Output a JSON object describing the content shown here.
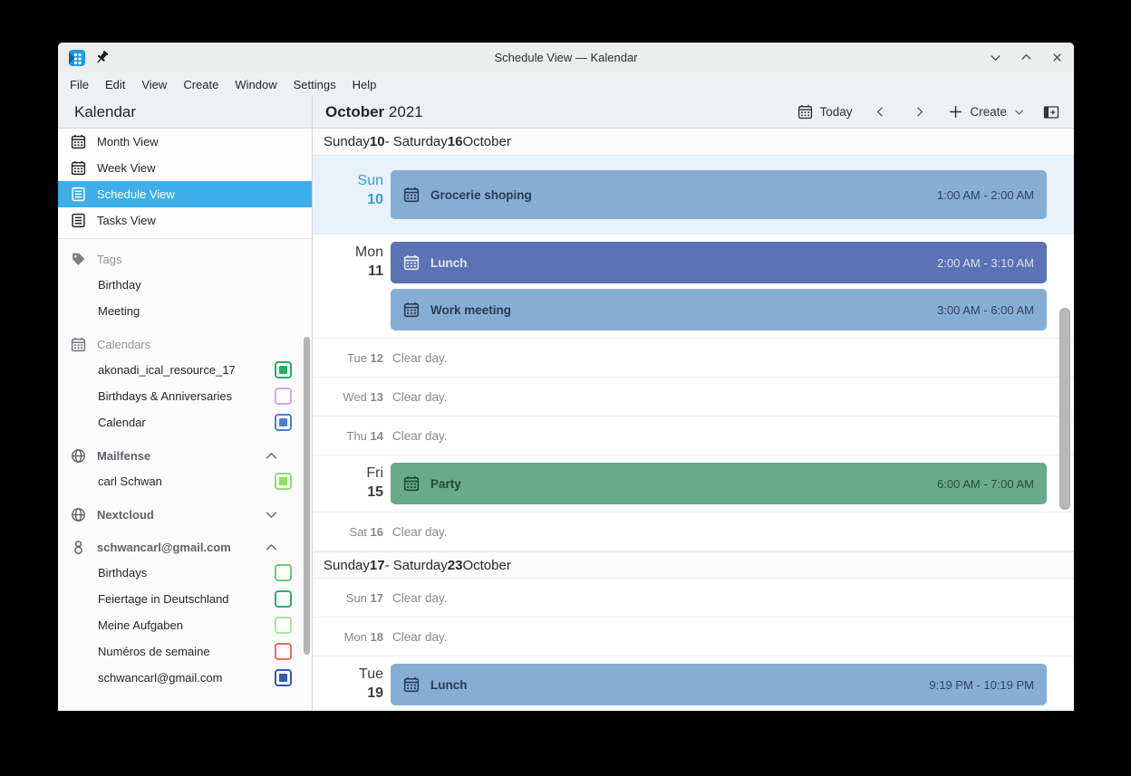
{
  "window": {
    "title": "Schedule View — Kalendar"
  },
  "menu_items": [
    "File",
    "Edit",
    "View",
    "Create",
    "Window",
    "Settings",
    "Help"
  ],
  "sidebar": {
    "app_title": "Kalendar",
    "views": [
      {
        "label": "Month View",
        "icon": "month-view-icon",
        "selected": false
      },
      {
        "label": "Week View",
        "icon": "week-view-icon",
        "selected": false
      },
      {
        "label": "Schedule View",
        "icon": "schedule-view-icon",
        "selected": true
      },
      {
        "label": "Tasks View",
        "icon": "tasks-view-icon",
        "selected": false
      }
    ],
    "sections": [
      {
        "title": "Tags",
        "icon": "tag-icon",
        "account": false,
        "collapse": null,
        "items": [
          {
            "label": "Birthday"
          },
          {
            "label": "Meeting"
          }
        ]
      },
      {
        "title": "Calendars",
        "icon": "calendar-icon",
        "account": false,
        "collapse": null,
        "items": [
          {
            "label": "akonadi_ical_resource_17",
            "checkbox": {
              "checked": true,
              "color": "#27ae60"
            }
          },
          {
            "label": "Birthdays & Anniversaries",
            "checkbox": {
              "checked": false,
              "color": "#d3a9f0"
            }
          },
          {
            "label": "Calendar",
            "checkbox": {
              "checked": true,
              "color": "#4a7fd0"
            }
          }
        ]
      },
      {
        "title": "Mailfense",
        "icon": "globe-icon",
        "account": true,
        "collapse": "up",
        "items": [
          {
            "label": "carl Schwan",
            "checkbox": {
              "checked": true,
              "color": "#8ce266"
            }
          }
        ]
      },
      {
        "title": "Nextcloud",
        "icon": "globe-icon",
        "account": true,
        "collapse": "down",
        "items": []
      },
      {
        "title": "schwancarl@gmail.com",
        "icon": "google-icon",
        "account": true,
        "collapse": "up",
        "items": [
          {
            "label": "Birthdays",
            "checkbox": {
              "checked": false,
              "color": "#68cc6d"
            }
          },
          {
            "label": "Feiertage in Deutschland",
            "checkbox": {
              "checked": false,
              "color": "#35ac6c"
            }
          },
          {
            "label": "Meine Aufgaben",
            "checkbox": {
              "checked": false,
              "color": "#a9e79d"
            }
          },
          {
            "label": "Numéros de semaine",
            "checkbox": {
              "checked": false,
              "color": "#f26d5b"
            }
          },
          {
            "label": "schwancarl@gmail.com",
            "checkbox": {
              "checked": true,
              "color": "#3557b0"
            }
          }
        ]
      }
    ]
  },
  "main": {
    "header": {
      "month": "October",
      "year": "2021",
      "today_label": "Today",
      "create_label": "Create"
    },
    "event_colors": {
      "light-blue": {
        "bg": "#86aed5",
        "fg": "#2b3a55"
      },
      "dark-blue": {
        "bg": "#5b73b4",
        "fg": "#e3e8f5"
      },
      "green": {
        "bg": "#69aa8b",
        "fg": "#1e4833"
      }
    },
    "weeks": [
      {
        "title": {
          "start_name": "Sunday",
          "start_num": "10",
          "dash": "-",
          "end_name": "Saturday",
          "end_num": "16",
          "month": "October"
        },
        "days": [
          {
            "name": "Sun",
            "num": "10",
            "today": true,
            "events": [
              {
                "title": "Grocerie shoping",
                "time": "1:00 AM - 2:00 AM",
                "variant": "light-blue"
              }
            ]
          },
          {
            "name": "Mon",
            "num": "11",
            "events": [
              {
                "title": "Lunch",
                "time": "2:00 AM - 3:10 AM",
                "variant": "dark-blue"
              },
              {
                "title": "Work meeting",
                "time": "3:00 AM - 6:00 AM",
                "variant": "light-blue"
              }
            ]
          },
          {
            "name": "Tue",
            "num": "12",
            "clear": "Clear day."
          },
          {
            "name": "Wed",
            "num": "13",
            "clear": "Clear day."
          },
          {
            "name": "Thu",
            "num": "14",
            "clear": "Clear day."
          },
          {
            "name": "Fri",
            "num": "15",
            "events": [
              {
                "title": "Party",
                "time": "6:00 AM - 7:00 AM",
                "variant": "green"
              }
            ]
          },
          {
            "name": "Sat",
            "num": "16",
            "clear": "Clear day."
          }
        ]
      },
      {
        "title": {
          "start_name": "Sunday",
          "start_num": "17",
          "dash": "-",
          "end_name": "Saturday",
          "end_num": "23",
          "month": "October"
        },
        "days": [
          {
            "name": "Sun",
            "num": "17",
            "clear": "Clear day."
          },
          {
            "name": "Mon",
            "num": "18",
            "clear": "Clear day."
          },
          {
            "name": "Tue",
            "num": "19",
            "events": [
              {
                "title": "Lunch",
                "time": "9:19 PM - 10:19 PM",
                "variant": "light-blue"
              }
            ]
          }
        ]
      }
    ]
  }
}
